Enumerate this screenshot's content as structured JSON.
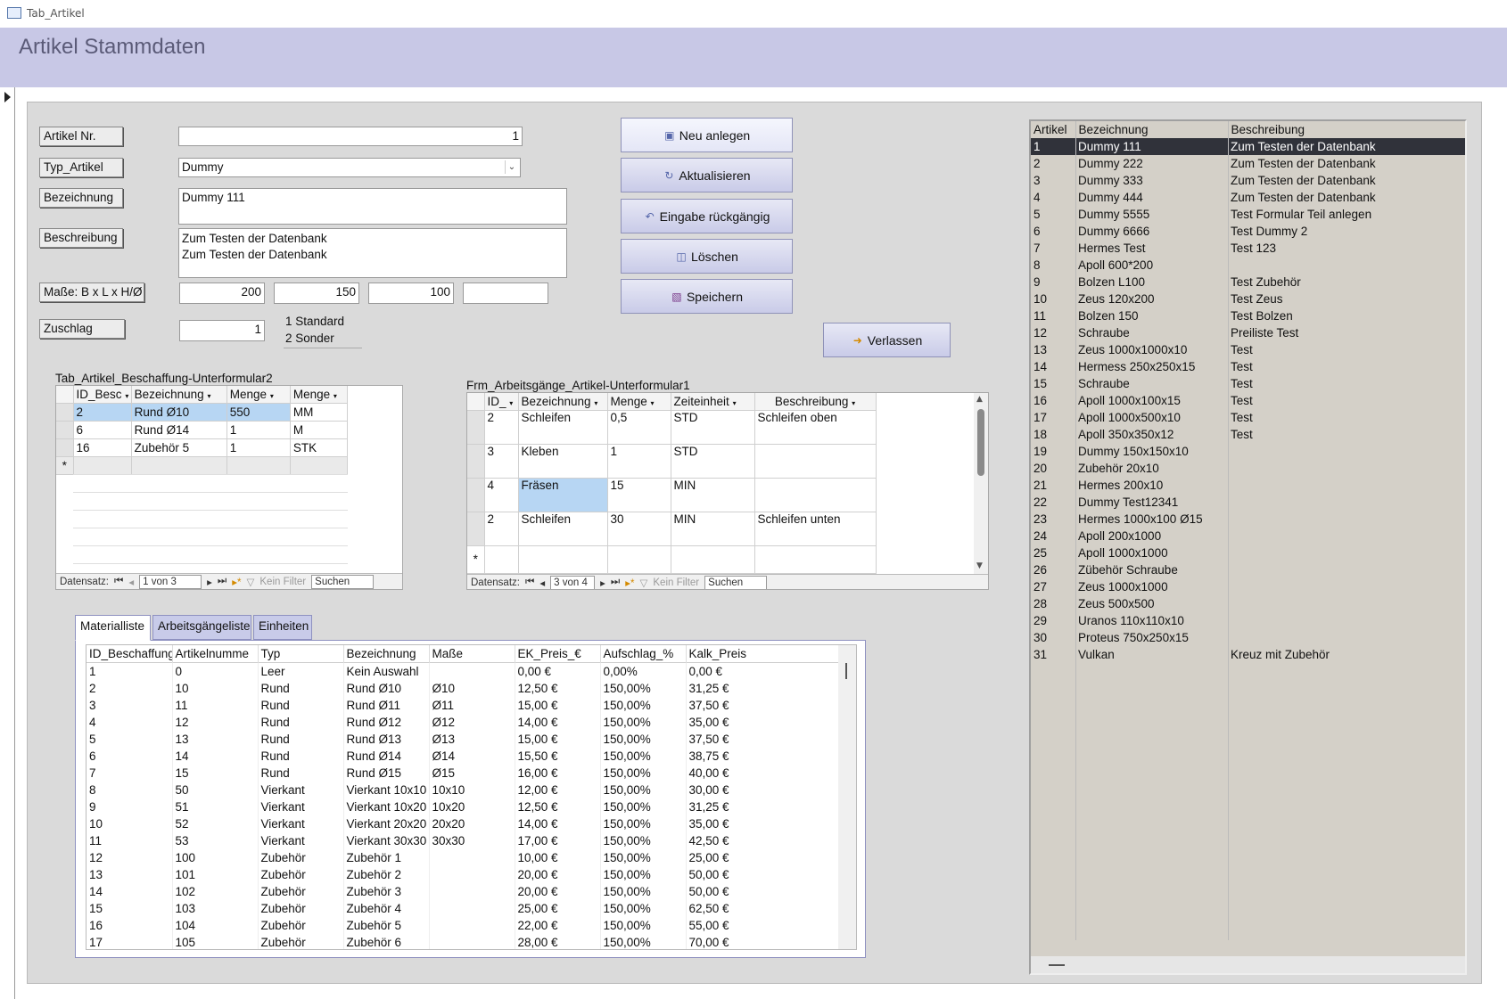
{
  "window": {
    "title": "Tab_Artikel"
  },
  "header": {
    "title": "Artikel Stammdaten"
  },
  "form": {
    "artikel_nr": {
      "label": "Artikel Nr.",
      "value": "1"
    },
    "typ": {
      "label": "Typ_Artikel",
      "value": "Dummy"
    },
    "bezeichnung": {
      "label": "Bezeichnung",
      "value": "Dummy 111"
    },
    "beschreibung": {
      "label": "Beschreibung",
      "line1": "Zum Testen der Datenbank",
      "line2": "Zum Testen der Datenbank"
    },
    "masse": {
      "label": "Maße: B x L x H/Ø",
      "b": "200",
      "l": "150",
      "h": "100",
      "d": ""
    },
    "zuschlag": {
      "label": "Zuschlag",
      "value": "1",
      "opt1": "1 Standard",
      "opt2": "2 Sonder"
    }
  },
  "buttons": {
    "neu": "Neu anlegen",
    "aktualisieren": "Aktualisieren",
    "rueckgaengig": "Eingabe rückgängig",
    "loeschen": "Löschen",
    "speichern": "Speichern",
    "verlassen": "Verlassen"
  },
  "sub1": {
    "title": "Tab_Artikel_Beschaffung-Unterformular2",
    "headers": [
      "ID_Besc",
      "Bezeichnung",
      "Menge",
      "Menge"
    ],
    "rows": [
      [
        "2",
        "Rund Ø10",
        "550",
        "MM"
      ],
      [
        "6",
        "Rund Ø14",
        "1",
        "M"
      ],
      [
        "16",
        "Zubehör 5",
        "1",
        "STK"
      ]
    ],
    "nav": {
      "label": "Datensatz:",
      "pos": "1 von 3",
      "filter": "Kein Filter",
      "search": "Suchen"
    }
  },
  "sub2": {
    "title": "Frm_Arbeitsgänge_Artikel-Unterformular1",
    "headers": [
      "ID_",
      "Bezeichnung",
      "Menge",
      "Zeiteinheit",
      "Beschreibung"
    ],
    "rows": [
      [
        "2",
        "Schleifen",
        "0,5",
        "STD",
        "Schleifen oben"
      ],
      [
        "3",
        "Kleben",
        "1",
        "STD",
        ""
      ],
      [
        "4",
        "Fräsen",
        "15",
        "MIN",
        ""
      ],
      [
        "2",
        "Schleifen",
        "30",
        "MIN",
        "Schleifen unten"
      ]
    ],
    "nav": {
      "label": "Datensatz:",
      "pos": "3 von 4",
      "filter": "Kein Filter",
      "search": "Suchen"
    }
  },
  "tabs": [
    "Materialliste",
    "Arbeitsgängeliste",
    "Einheiten"
  ],
  "materialliste": {
    "headers": [
      "ID_Beschaffung",
      "Artikelnumme",
      "Typ",
      "Bezeichnung",
      "Maße",
      "EK_Preis_€",
      "Aufschlag_%",
      "Kalk_Preis"
    ],
    "rows": [
      [
        "1",
        "0",
        "Leer",
        "Kein Auswahl",
        "",
        "0,00 €",
        "0,00%",
        "0,00 €"
      ],
      [
        "2",
        "10",
        "Rund",
        "Rund Ø10",
        "Ø10",
        "12,50 €",
        "150,00%",
        "31,25 €"
      ],
      [
        "3",
        "11",
        "Rund",
        "Rund Ø11",
        "Ø11",
        "15,00 €",
        "150,00%",
        "37,50 €"
      ],
      [
        "4",
        "12",
        "Rund",
        "Rund Ø12",
        "Ø12",
        "14,00 €",
        "150,00%",
        "35,00 €"
      ],
      [
        "5",
        "13",
        "Rund",
        "Rund Ø13",
        "Ø13",
        "15,00 €",
        "150,00%",
        "37,50 €"
      ],
      [
        "6",
        "14",
        "Rund",
        "Rund Ø14",
        "Ø14",
        "15,50 €",
        "150,00%",
        "38,75 €"
      ],
      [
        "7",
        "15",
        "Rund",
        "Rund Ø15",
        "Ø15",
        "16,00 €",
        "150,00%",
        "40,00 €"
      ],
      [
        "8",
        "50",
        "Vierkant",
        "Vierkant 10x10",
        "10x10",
        "12,00 €",
        "150,00%",
        "30,00 €"
      ],
      [
        "9",
        "51",
        "Vierkant",
        "Vierkant 10x20",
        "10x20",
        "12,50 €",
        "150,00%",
        "31,25 €"
      ],
      [
        "10",
        "52",
        "Vierkant",
        "Vierkant 20x20",
        "20x20",
        "14,00 €",
        "150,00%",
        "35,00 €"
      ],
      [
        "11",
        "53",
        "Vierkant",
        "Vierkant 30x30",
        "30x30",
        "17,00 €",
        "150,00%",
        "42,50 €"
      ],
      [
        "12",
        "100",
        "Zubehör",
        "Zubehör 1",
        "",
        "10,00 €",
        "150,00%",
        "25,00 €"
      ],
      [
        "13",
        "101",
        "Zubehör",
        "Zubehör 2",
        "",
        "20,00 €",
        "150,00%",
        "50,00 €"
      ],
      [
        "14",
        "102",
        "Zubehör",
        "Zubehör 3",
        "",
        "20,00 €",
        "150,00%",
        "50,00 €"
      ],
      [
        "15",
        "103",
        "Zubehör",
        "Zubehör 4",
        "",
        "25,00 €",
        "150,00%",
        "62,50 €"
      ],
      [
        "16",
        "104",
        "Zubehör",
        "Zubehör 5",
        "",
        "22,00 €",
        "150,00%",
        "55,00 €"
      ],
      [
        "17",
        "105",
        "Zubehör",
        "Zubehör 6",
        "",
        "28,00 €",
        "150,00%",
        "70,00 €"
      ]
    ]
  },
  "artikelliste": {
    "headers": [
      "Artikel",
      "Bezeichnung",
      "Beschreibung"
    ],
    "selected_index": 0,
    "rows": [
      [
        "1",
        "Dummy 111",
        "Zum Testen der Datenbank"
      ],
      [
        "2",
        "Dummy 222",
        "Zum Testen der Datenbank"
      ],
      [
        "3",
        "Dummy 333",
        "Zum Testen der Datenbank"
      ],
      [
        "4",
        "Dummy 444",
        "Zum Testen der Datenbank"
      ],
      [
        "5",
        "Dummy 5555",
        "Test Formular Teil anlegen"
      ],
      [
        "6",
        "Dummy 6666",
        "Test Dummy 2"
      ],
      [
        "7",
        "Hermes Test",
        "Test 123"
      ],
      [
        "8",
        "Apoll 600*200",
        ""
      ],
      [
        "9",
        "Bolzen L100",
        "Test Zubehör"
      ],
      [
        "10",
        "Zeus 120x200",
        "Test Zeus"
      ],
      [
        "11",
        "Bolzen 150",
        "Test Bolzen"
      ],
      [
        "12",
        "Schraube",
        "Preiliste Test"
      ],
      [
        "13",
        "Zeus 1000x1000x10",
        "Test"
      ],
      [
        "14",
        "Hermess 250x250x15",
        "Test"
      ],
      [
        "15",
        "Schraube",
        "Test"
      ],
      [
        "16",
        "Apoll 1000x100x15",
        "Test"
      ],
      [
        "17",
        "Apoll 1000x500x10",
        "Test"
      ],
      [
        "18",
        "Apoll 350x350x12",
        "Test"
      ],
      [
        "19",
        "Dummy 150x150x10",
        ""
      ],
      [
        "20",
        "Zubehör 20x10",
        ""
      ],
      [
        "21",
        "Hermes 200x10",
        ""
      ],
      [
        "22",
        "Dummy Test12341",
        ""
      ],
      [
        "23",
        "Hermes 1000x100 Ø15",
        ""
      ],
      [
        "24",
        "Apoll 200x1000",
        ""
      ],
      [
        "25",
        "Apoll 1000x1000",
        ""
      ],
      [
        "26",
        "Zübehör Schraube",
        ""
      ],
      [
        "27",
        "Zeus 1000x1000",
        ""
      ],
      [
        "28",
        "Zeus 500x500",
        ""
      ],
      [
        "29",
        "Uranos 110x110x10",
        ""
      ],
      [
        "30",
        "Proteus 750x250x15",
        ""
      ],
      [
        "31",
        "Vulkan",
        "Kreuz mit Zubehör"
      ]
    ]
  }
}
